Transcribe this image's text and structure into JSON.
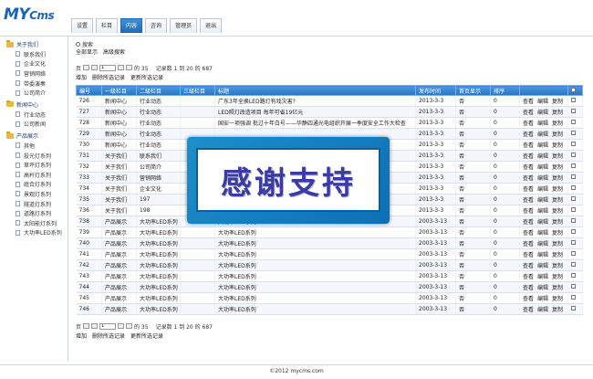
{
  "header": {
    "logo": "MY",
    "logo_sub": "Cms",
    "nav": [
      "设置",
      "栏目",
      "内容",
      "咨询",
      "管理员",
      "退出"
    ],
    "active_nav": 2
  },
  "sidebar": {
    "groups": [
      {
        "title": "关于我们",
        "items": [
          "联系我们",
          "企业文化",
          "营销网络",
          "带委演奏",
          "公司简介"
        ]
      },
      {
        "title": "新闻中心",
        "items": [
          "行业动态",
          "公司新闻"
        ]
      },
      {
        "title": "产品展示",
        "items": [
          "其他",
          "投光灯系列",
          "草坪灯系列",
          "高杆灯系列",
          "庭合灯系列",
          "景观灯系列",
          "隧道灯系列",
          "道路灯系列",
          "太阳能灯系列",
          "大功率LED系列"
        ]
      }
    ]
  },
  "main": {
    "search_label": "搜索",
    "filters": [
      "全部显示",
      "高级搜索"
    ],
    "pager": {
      "prefix": "页",
      "page": "1",
      "total_pages": "的 35",
      "summary": "记录数 1 到 20 的 687"
    },
    "actions": [
      "增加",
      "删除所选记录",
      "更新所选记录"
    ],
    "columns": [
      "编号",
      "一级栏目",
      "二级栏目",
      "三级栏目",
      "标题",
      "发布时间",
      "首页显示",
      "排序",
      "",
      ""
    ],
    "row_ops": [
      "查看",
      "编辑",
      "复制"
    ],
    "rows": [
      [
        "726",
        "新闻中心",
        "行业动态",
        "",
        "广东3年全换LED路灯有戏灾害?",
        "2013-3-3",
        "否",
        "0"
      ],
      [
        "727",
        "新闻中心",
        "行业动态",
        "",
        "LED照灯改造项目 每年可省19亿元",
        "2013-3-3",
        "否",
        "0"
      ],
      [
        "728",
        "新闻中心",
        "行业动态",
        "",
        "国安一项强调 批过十年白号——华静四通光电组织开展一季度安全工作大检查",
        "2013-3-3",
        "否",
        "0"
      ],
      [
        "729",
        "新闻中心",
        "行业动态",
        "",
        "",
        "2013-3-3",
        "否",
        "0"
      ],
      [
        "730",
        "新闻中心",
        "行业动态",
        "",
        "",
        "2013-3-3",
        "否",
        "0"
      ],
      [
        "731",
        "关于我们",
        "联系我们",
        "",
        "",
        "2013-3-3",
        "否",
        "0"
      ],
      [
        "732",
        "关于我们",
        "公司简介",
        "",
        "",
        "2013-3-3",
        "否",
        "0"
      ],
      [
        "733",
        "关于我们",
        "营销网络",
        "",
        "",
        "2013-3-3",
        "否",
        "0"
      ],
      [
        "734",
        "关于我们",
        "企业文化",
        "",
        "",
        "2013-3-3",
        "否",
        "0"
      ],
      [
        "735",
        "关于我们",
        "197",
        "",
        "",
        "2013-3-3",
        "否",
        "0"
      ],
      [
        "736",
        "关于我们",
        "198",
        "",
        "",
        "2013-3-3",
        "否",
        "0"
      ],
      [
        "738",
        "产品展示",
        "大功率LED系列",
        "",
        "大功率LED系列",
        "2003-3-13",
        "否",
        "0"
      ],
      [
        "739",
        "产品展示",
        "大功率LED系列",
        "",
        "大功率LED系列",
        "2003-3-13",
        "否",
        "0"
      ],
      [
        "740",
        "产品展示",
        "大功率LED系列",
        "",
        "大功率LED系列",
        "2003-3-13",
        "否",
        "0"
      ],
      [
        "741",
        "产品展示",
        "大功率LED系列",
        "",
        "大功率LED系列",
        "2003-3-13",
        "否",
        "0"
      ],
      [
        "742",
        "产品展示",
        "大功率LED系列",
        "",
        "大功率LED系列",
        "2003-3-13",
        "否",
        "0"
      ],
      [
        "743",
        "产品展示",
        "大功率LED系列",
        "",
        "大功率LED系列",
        "2003-3-13",
        "否",
        "0"
      ],
      [
        "744",
        "产品展示",
        "大功率LED系列",
        "",
        "大功率LED系列",
        "2003-3-13",
        "否",
        "0"
      ],
      [
        "745",
        "产品展示",
        "大功率LED系列",
        "",
        "大功率LED系列",
        "2003-3-13",
        "否",
        "0"
      ],
      [
        "746",
        "产品展示",
        "大功率LED系列",
        "",
        "大功率LED系列",
        "2003-3-13",
        "否",
        "0"
      ]
    ]
  },
  "overlay": {
    "text": "感谢支持"
  },
  "footer": {
    "text": "©2012 mycms.com"
  },
  "colors": {
    "accent": "#1e69b8",
    "header_row": "#2a73c2",
    "overlay": "#1d8fc8"
  }
}
